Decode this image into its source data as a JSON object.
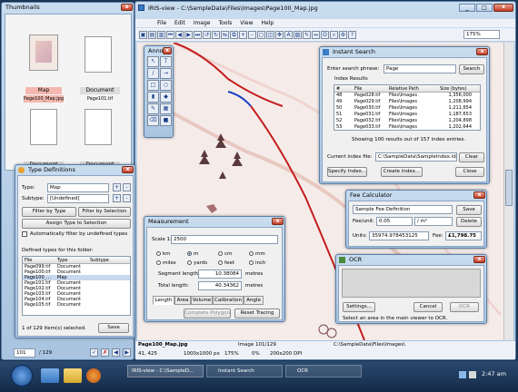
{
  "app": {
    "title": "IRIS-view - C:\\SampleData\\Files\\Images\\Page100_Map.jpg",
    "menu": [
      "File",
      "Edit",
      "Image",
      "Tools",
      "View",
      "Help"
    ],
    "zoom": "175%"
  },
  "thumbs": {
    "title": "Thumbnails",
    "items": [
      {
        "label": "Map",
        "caption": "Page100_Map.jpg",
        "selected": true
      },
      {
        "label": "Document",
        "caption": "Page101.tif",
        "selected": false
      },
      {
        "label": "Document",
        "caption": "",
        "selected": false
      },
      {
        "label": "Document",
        "caption": "",
        "selected": false
      }
    ],
    "page": "101",
    "total": "/ 129"
  },
  "typedef": {
    "title": "Type Definitions",
    "type_label": "Type:",
    "type_value": "Map",
    "subtype_label": "Subtype:",
    "subtype_value": "[Undefined]",
    "filter_type": "Filter by Type",
    "filter_sel": "Filter by Selection",
    "assign": "Assign Type to Selection",
    "auto_filter": "Automatically filter by undefined types",
    "defined_label": "Defined types for this folder:",
    "cols": [
      "File",
      "Type",
      "Subtype"
    ],
    "rows": [
      [
        "Page099.tif",
        "Document",
        ""
      ],
      [
        "Page100.tif",
        "Document",
        ""
      ],
      [
        "Page100_...",
        "Map",
        ""
      ],
      [
        "Page101.tif",
        "Document",
        ""
      ],
      [
        "Page102.tif",
        "Document",
        ""
      ],
      [
        "Page103.tif",
        "Document",
        ""
      ],
      [
        "Page104.tif",
        "Document",
        ""
      ],
      [
        "Page105.tif",
        "Document",
        ""
      ]
    ],
    "status": "1 of 129 item(s) selected.",
    "save": "Save"
  },
  "anno": {
    "title": "Anno"
  },
  "search": {
    "title": "Instant Search",
    "phrase_label": "Enter search phrase:",
    "phrase": "Page",
    "search_btn": "Search",
    "results_label": "Index Results",
    "cols": [
      "#",
      "File",
      "Relative Path",
      "Size (bytes)"
    ],
    "rows": [
      [
        "48",
        "Page028.tif",
        "Files\\Images",
        "1,356,000"
      ],
      [
        "49",
        "Page029.tif",
        "Files\\Images",
        "1,208,994"
      ],
      [
        "50",
        "Page030.tif",
        "Files\\Images",
        "1,211,654"
      ],
      [
        "51",
        "Page031.tif",
        "Files\\Images",
        "1,187,653"
      ],
      [
        "52",
        "Page032.tif",
        "Files\\Images",
        "1,204,898"
      ],
      [
        "53",
        "Page033.tif",
        "Files\\Images",
        "1,202,644"
      ]
    ],
    "showing": "Showing 100 results out of 157 index entries.",
    "index_label": "Current index file:",
    "index_file": "C:\\SampleData\\SampleIndex.idx",
    "clear": "Clear",
    "specify": "Specify Index...",
    "create": "Create Index...",
    "close": "Close"
  },
  "fee": {
    "title": "Fee Calculator",
    "def": "Sample Fee Definition",
    "save": "Save",
    "unit_label": "Fee/unit:",
    "unit_value": "0.05",
    "unit": "/ m²",
    "delete": "Delete",
    "units_label": "Units:",
    "units_value": "35974.978453125",
    "fee_label": "Fee:",
    "fee_value": "£1,798.75"
  },
  "measure": {
    "title": "Measurement",
    "scale_label": "Scale 1:",
    "scale": "2500",
    "units": [
      [
        "km",
        false
      ],
      [
        "m",
        true
      ],
      [
        "cm",
        false
      ],
      [
        "mm",
        false
      ],
      [
        "miles",
        false
      ],
      [
        "yards",
        false
      ],
      [
        "feet",
        false
      ],
      [
        "inch",
        false
      ]
    ],
    "seg_label": "Segment length:",
    "seg": "10.38084",
    "seg_unit": "metres",
    "tot_label": "Total length:",
    "tot": "40.34362",
    "tot_unit": "metres",
    "tabs": [
      "Length",
      "Area",
      "Volume",
      "Calibration",
      "Angle"
    ],
    "complete": "Complete Polygon",
    "reset": "Reset Tracing"
  },
  "ocr": {
    "title": "OCR",
    "settings": "Settings...",
    "cancel": "Cancel",
    "ok": "OCR",
    "status": "Select an area in the main viewer to OCR."
  },
  "status": {
    "file": "Page100_Map.jpg",
    "image": "Image 101/129",
    "path": "C:\\SampleData\\Files\\Images\\",
    "coords": "41, 425",
    "size": "1000x1000 px",
    "zoom": "175%",
    "percent": "0%",
    "dpi": "200x200 DPI"
  },
  "taskbar": {
    "items": [
      "IRIS-view - C:\\SampleD...",
      "Instant Search",
      "OCR"
    ],
    "time": "2:47 am"
  }
}
